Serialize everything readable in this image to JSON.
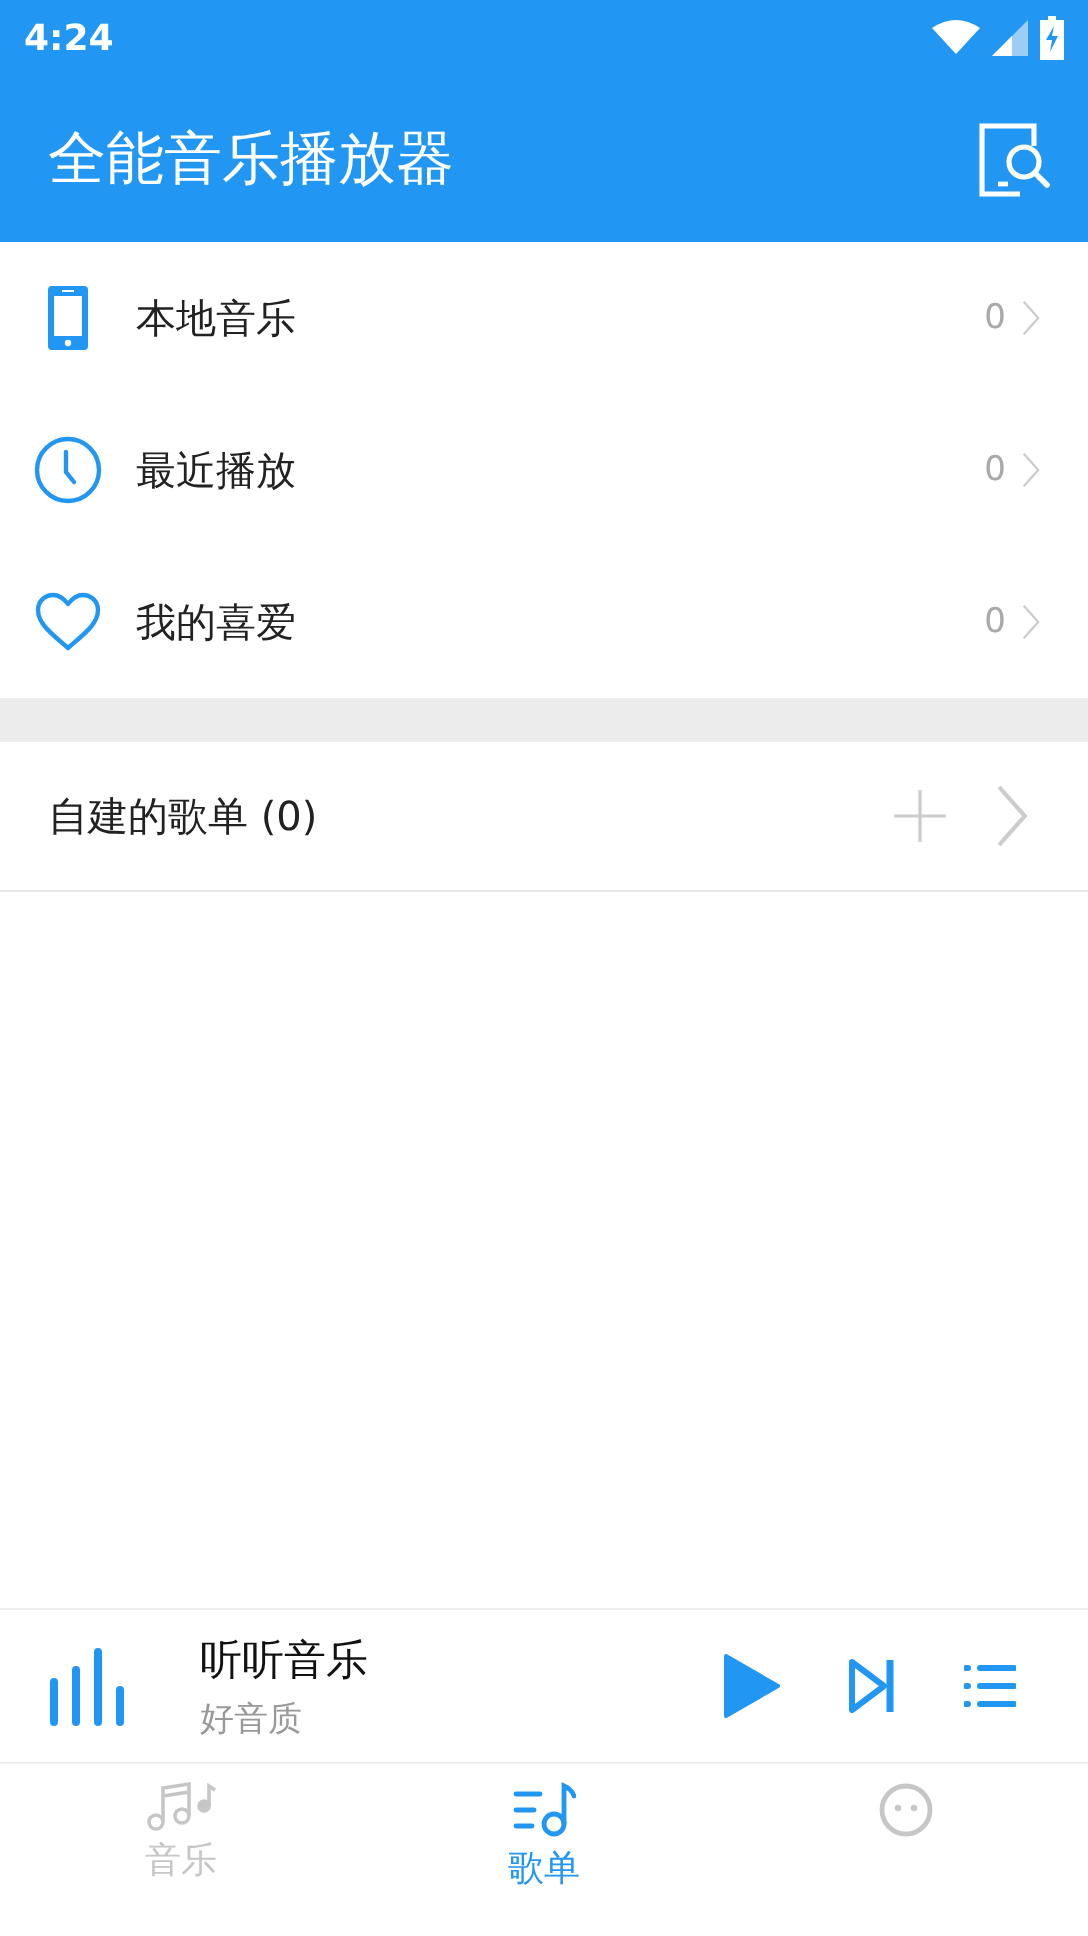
{
  "status_bar": {
    "time": "4:24"
  },
  "app_bar": {
    "title": "全能音乐播放器"
  },
  "library": [
    {
      "kind": "phone",
      "label": "本地音乐",
      "count": "0"
    },
    {
      "kind": "clock",
      "label": "最近播放",
      "count": "0"
    },
    {
      "kind": "heart",
      "label": "我的喜爱",
      "count": "0"
    }
  ],
  "playlists": {
    "title": "自建的歌单 (0)"
  },
  "mini_player": {
    "title": "听听音乐",
    "subtitle": "好音质"
  },
  "bottom_nav": [
    {
      "kind": "music",
      "label": "音乐",
      "selected": false
    },
    {
      "kind": "playlist",
      "label": "歌单",
      "selected": true
    },
    {
      "kind": "face",
      "selected": false
    }
  ]
}
